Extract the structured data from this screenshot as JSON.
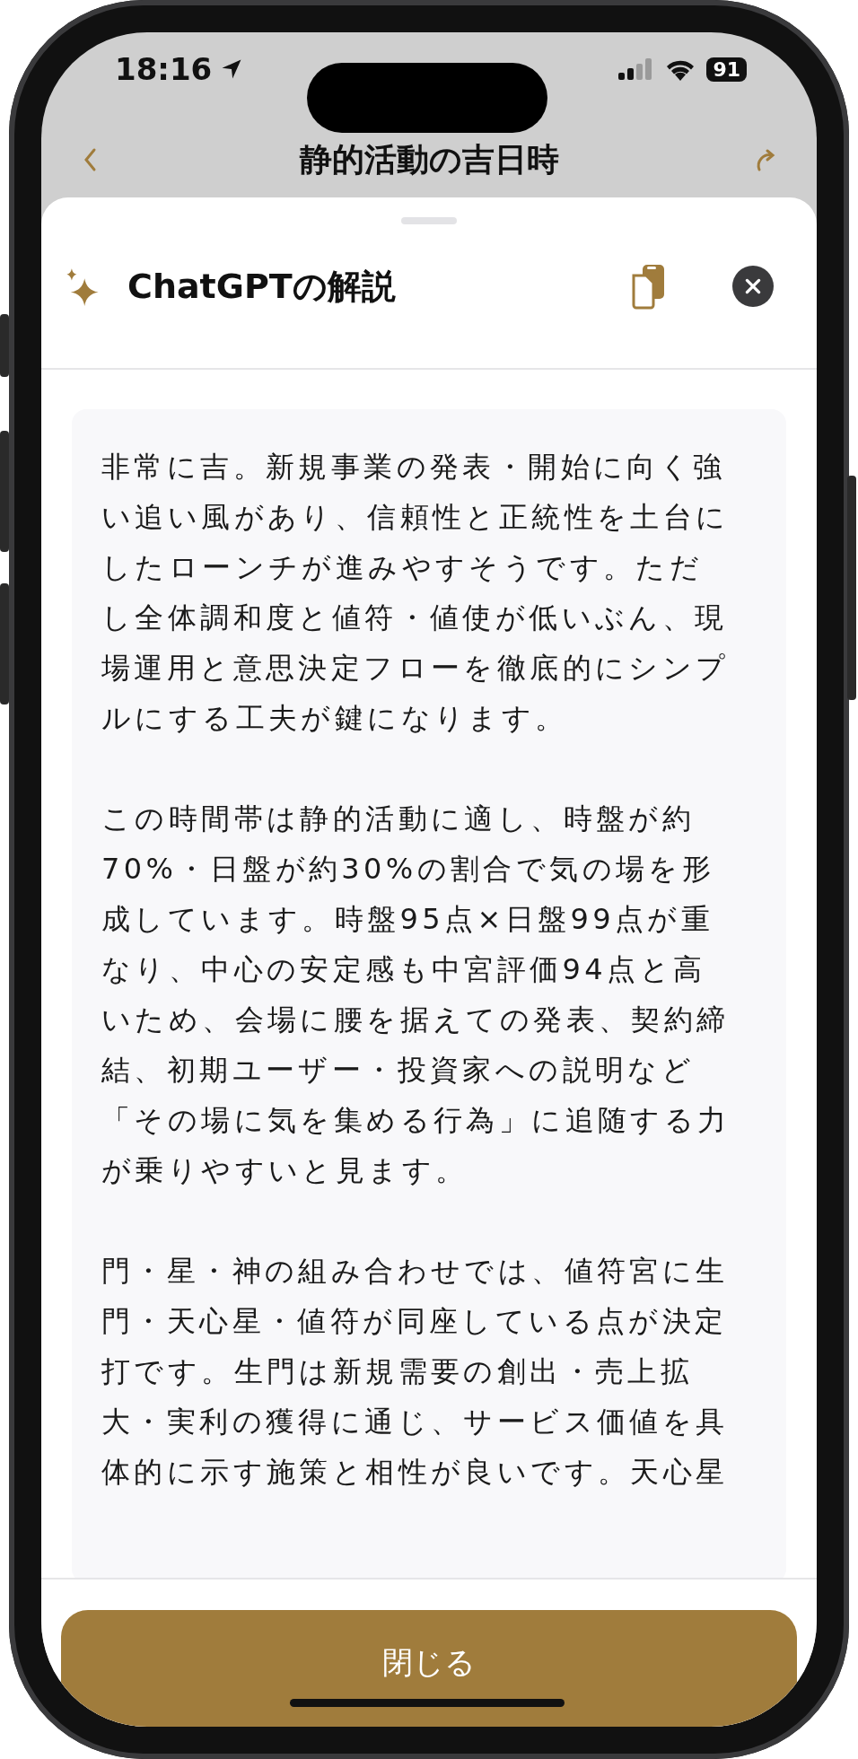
{
  "status_bar": {
    "time": "18:16",
    "battery": "91"
  },
  "background_nav": {
    "title": "静的活動の吉日時"
  },
  "sheet": {
    "title": "ChatGPTの解説",
    "paragraphs": [
      "非常に吉。新規事業の発表・開始に向く強い追い風があり、信頼性と正統性を土台にしたローンチが進みやすそうです。ただし全体調和度と値符・値使が低いぶん、現場運用と意思決定フローを徹底的にシンプルにする工夫が鍵になります。",
      "この時間帯は静的活動に適し、時盤が約70%・日盤が約30%の割合で気の場を形成しています。時盤95点×日盤99点が重なり、中心の安定感も中宮評価94点と高いため、会場に腰を据えての発表、契約締結、初期ユーザー・投資家への説明など「その場に気を集める行為」に追随する力が乗りやすいと見ます。",
      "門・星・神の組み合わせでは、値符宮に生門・天心星・値符が同座している点が決定打です。生門は新規需要の創出・売上拡大・実利の獲得に通じ、サービス価値を具体的に示す施策と相性が良いです。天心星"
    ],
    "close_button": "閉じる"
  }
}
